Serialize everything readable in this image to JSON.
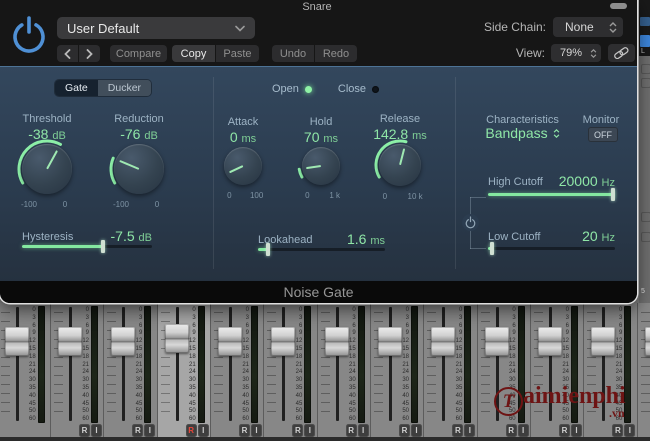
{
  "header": {
    "window_title": "Snare",
    "preset": "User Default",
    "compare": "Compare",
    "copy": "Copy",
    "paste": "Paste",
    "undo": "Undo",
    "redo": "Redo",
    "side_chain_label": "Side Chain:",
    "side_chain_value": "None",
    "view_label": "View:",
    "view_value": "79%"
  },
  "tabs": {
    "gate": "Gate",
    "ducker": "Ducker"
  },
  "indicators": {
    "open": "Open",
    "close": "Close"
  },
  "knobs": [
    {
      "id": "threshold",
      "label": "Threshold",
      "value": "-38",
      "unit": "dB",
      "min": "-100",
      "max": "0",
      "frac": 0.62
    },
    {
      "id": "reduction",
      "label": "Reduction",
      "value": "-76",
      "unit": "dB",
      "min": "-100",
      "max": "0",
      "frac": 0.22
    },
    {
      "id": "attack",
      "label": "Attack",
      "value": "0",
      "unit": "ms",
      "min": "0",
      "max": "100",
      "frac": 0.02
    },
    {
      "id": "hold",
      "label": "Hold",
      "value": "70",
      "unit": "ms",
      "min": "0",
      "max": "1 k",
      "frac": 0.09
    },
    {
      "id": "release",
      "label": "Release",
      "value": "142.8",
      "unit": "ms",
      "min": "0",
      "max": "10 k",
      "frac": 0.56
    }
  ],
  "sliders": [
    {
      "id": "hysteresis",
      "label": "Hysteresis",
      "value": "-7.5",
      "unit": "dB",
      "frac": 0.62
    },
    {
      "id": "lookahead",
      "label": "Lookahead",
      "value": "1.6",
      "unit": "ms",
      "frac": 0.08
    },
    {
      "id": "high-cutoff",
      "label": "High Cutoff",
      "value": "20000",
      "unit": "Hz",
      "frac": 1.0
    },
    {
      "id": "low-cutoff",
      "label": "Low Cutoff",
      "value": "20",
      "unit": "Hz",
      "frac": 0.03
    }
  ],
  "characteristics": {
    "label": "Characteristics",
    "value": "Bandpass"
  },
  "monitor": {
    "label": "Monitor",
    "value": "OFF"
  },
  "footer": {
    "title": "Noise Gate"
  },
  "mixer": {
    "scale": [
      0,
      3,
      6,
      9,
      12,
      15,
      18,
      21,
      24,
      30,
      35,
      40,
      45,
      50,
      60
    ],
    "record_label": "R",
    "input_label": "I",
    "strips": [
      {
        "selected": false,
        "buttons": false,
        "red_r": false
      },
      {
        "selected": false,
        "buttons": true,
        "red_r": false
      },
      {
        "selected": false,
        "buttons": true,
        "red_r": false
      },
      {
        "selected": true,
        "buttons": true,
        "red_r": true
      },
      {
        "selected": false,
        "buttons": true,
        "red_r": false
      },
      {
        "selected": false,
        "buttons": true,
        "red_r": false
      },
      {
        "selected": false,
        "buttons": true,
        "red_r": false
      },
      {
        "selected": false,
        "buttons": true,
        "red_r": false
      },
      {
        "selected": false,
        "buttons": true,
        "red_r": false
      },
      {
        "selected": false,
        "buttons": true,
        "red_r": false
      },
      {
        "selected": false,
        "buttons": true,
        "red_r": false
      },
      {
        "selected": false,
        "buttons": true,
        "red_r": false
      },
      {
        "selected": false,
        "buttons": false,
        "red_r": false
      }
    ],
    "side_labels": {
      "l": "L",
      "num": "5"
    }
  },
  "watermark": {
    "initial": "T",
    "brand": "aimienphi",
    "tld": ".vn"
  },
  "colors": {
    "accent_green": "#8df0a8",
    "power_blue": "#4f90d5",
    "panel_blue": "#2b3c4f",
    "watermark_red": "#6e1414",
    "chip_blue": "#3d87dd"
  }
}
